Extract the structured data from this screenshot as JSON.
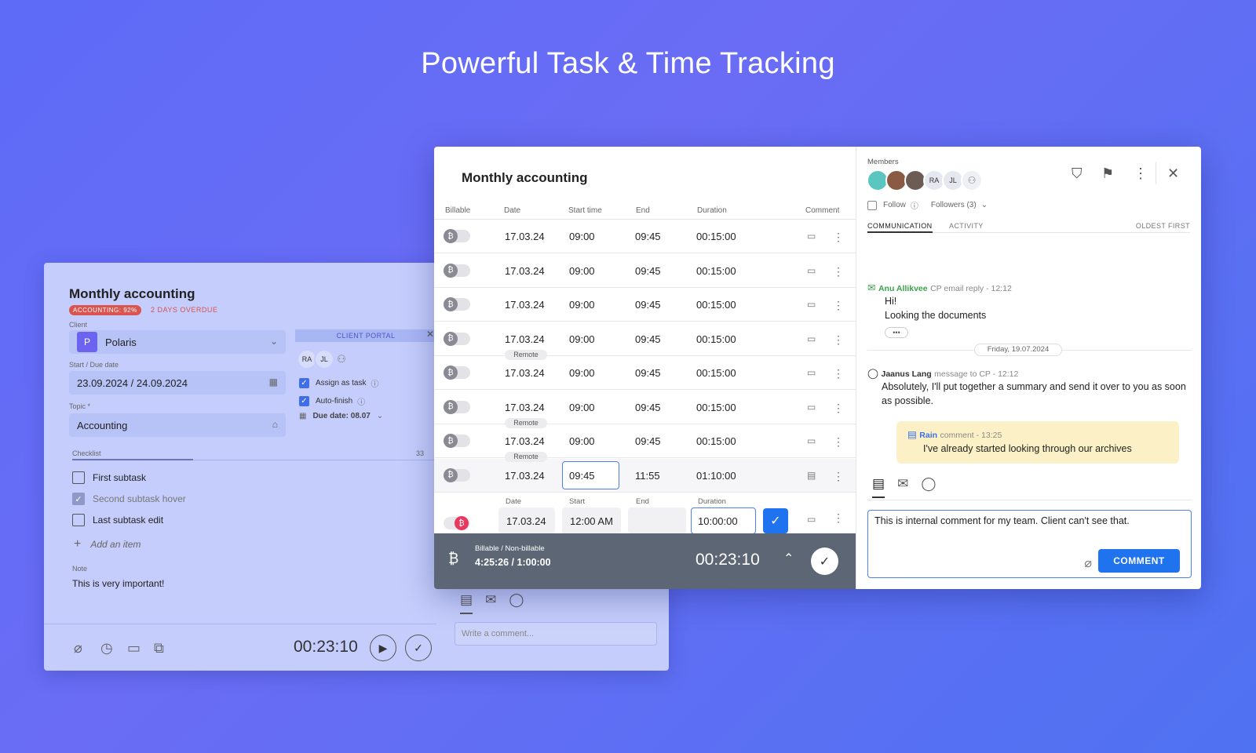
{
  "hero": {
    "title": "Powerful Task & Time Tracking"
  },
  "back": {
    "title": "Monthly accounting",
    "badge": "ACCOUNTING: 92%",
    "overdue": "2 DAYS OVERDUE",
    "client_label": "Client",
    "client_initial": "P",
    "client_value": "Polaris",
    "dates_label": "Start / Due date",
    "dates_value": "23.09.2024 / 24.09.2024",
    "topic_label": "Topic *",
    "topic_value": "Accounting",
    "portal_label": "CLIENT PORTAL",
    "portal_avatars": [
      "RA",
      "JL"
    ],
    "assign_label": "Assign as task",
    "autofinish_label": "Auto-finish",
    "due_label": "Due date: 08.07",
    "checklist_label": "Checklist",
    "checklist_count": "33",
    "checklist": [
      {
        "label": "First subtask",
        "checked": false
      },
      {
        "label": "Second subtask hover",
        "checked": true
      },
      {
        "label": "Last subtask edit",
        "checked": false
      }
    ],
    "add_item": "Add an item",
    "note_label": "Note",
    "note_value": "This is very important!",
    "timer": "00:23:10",
    "comment_placeholder": "Write a comment..."
  },
  "front": {
    "title": "Monthly accounting",
    "headers": {
      "billable": "Billable",
      "date": "Date",
      "start": "Start time",
      "end": "End",
      "duration": "Duration",
      "comment": "Comment"
    },
    "rows": [
      {
        "date": "17.03.24",
        "start": "09:00",
        "end": "09:45",
        "duration": "00:15:00",
        "remote": ""
      },
      {
        "date": "17.03.24",
        "start": "09:00",
        "end": "09:45",
        "duration": "00:15:00",
        "remote": ""
      },
      {
        "date": "17.03.24",
        "start": "09:00",
        "end": "09:45",
        "duration": "00:15:00",
        "remote": ""
      },
      {
        "date": "17.03.24",
        "start": "09:00",
        "end": "09:45",
        "duration": "00:15:00",
        "remote": "Remote"
      },
      {
        "date": "17.03.24",
        "start": "09:00",
        "end": "09:45",
        "duration": "00:15:00",
        "remote": ""
      },
      {
        "date": "17.03.24",
        "start": "09:00",
        "end": "09:45",
        "duration": "00:15:00",
        "remote": "Remote"
      },
      {
        "date": "17.03.24",
        "start": "09:00",
        "end": "09:45",
        "duration": "00:15:00",
        "remote": "Remote"
      },
      {
        "date": "17.03.24",
        "start": "09:45",
        "end": "11:55",
        "duration": "01:10:00",
        "remote": ""
      }
    ],
    "edit": {
      "date_label": "Date",
      "start_label": "Start",
      "end_label": "End",
      "duration_label": "Duration",
      "date": "17.03.24",
      "start": "12:00 AM",
      "end": "",
      "duration": "10:00:00"
    },
    "bar": {
      "label": "Billable / Non-billable",
      "value": "4:25:26 / 1:00:00",
      "timer": "00:23:10"
    },
    "members_label": "Members",
    "members": [
      "RA",
      "JL"
    ],
    "follow_label": "Follow",
    "followers_label": "Followers (3)",
    "tab_communication": "COMMUNICATION",
    "tab_activity": "ACTIVITY",
    "sort_label": "OLDEST FIRST",
    "msg1": {
      "author": "Anu Allikvee",
      "meta": "CP email reply - 12:12",
      "line1": "Hi!",
      "line2": "Looking the documents"
    },
    "date_sep": "Friday, 19.07.2024",
    "msg2": {
      "author": "Jaanus Lang",
      "meta": "message to CP - 12:12",
      "text": "Absolutely, I'll put together a summary and send it over to you as soon as possible."
    },
    "msg3": {
      "author": "Rain",
      "meta": "comment - 13:25",
      "text": "I've already started looking through our archives"
    },
    "comment_text": "This is internal comment for my team. Client can't see that.",
    "comment_button": "COMMENT"
  },
  "colors": {
    "accent": "#1f73ee",
    "danger": "#d9534f",
    "background": "#5d6bf7"
  }
}
